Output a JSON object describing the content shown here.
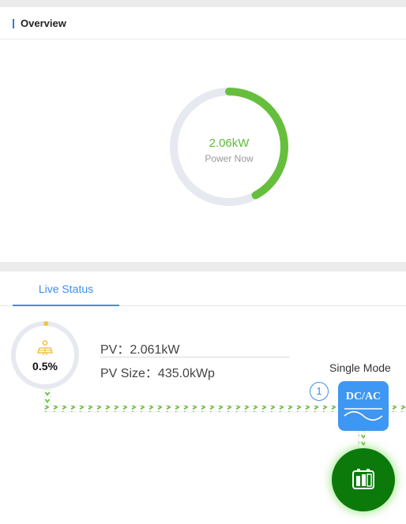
{
  "overview": {
    "title": "Overview",
    "power_now_value": "2.06kW",
    "power_now_label": "Power Now",
    "gauge_fraction": 0.42
  },
  "tabs": {
    "live_status": "Live Status"
  },
  "pv": {
    "percent": "0.5%",
    "percent_fraction": 0.005,
    "power": "PV：2.061kW",
    "size": "PV Size：435.0kWp"
  },
  "inverter": {
    "mode": "Single Mode",
    "badge": "1",
    "label": "DC/AC"
  },
  "colors": {
    "accent": "#3c8ee8",
    "gauge_fill": "#66bf3c",
    "gauge_track": "#e6e9f0",
    "pv_dot": "#f5c242",
    "battery": "#0b7a0b",
    "flow_arrow": "#6fbf40"
  },
  "icons": {
    "pv": "solar-panel-icon",
    "inverter": "dc-ac-inverter-icon",
    "battery": "battery-icon"
  }
}
